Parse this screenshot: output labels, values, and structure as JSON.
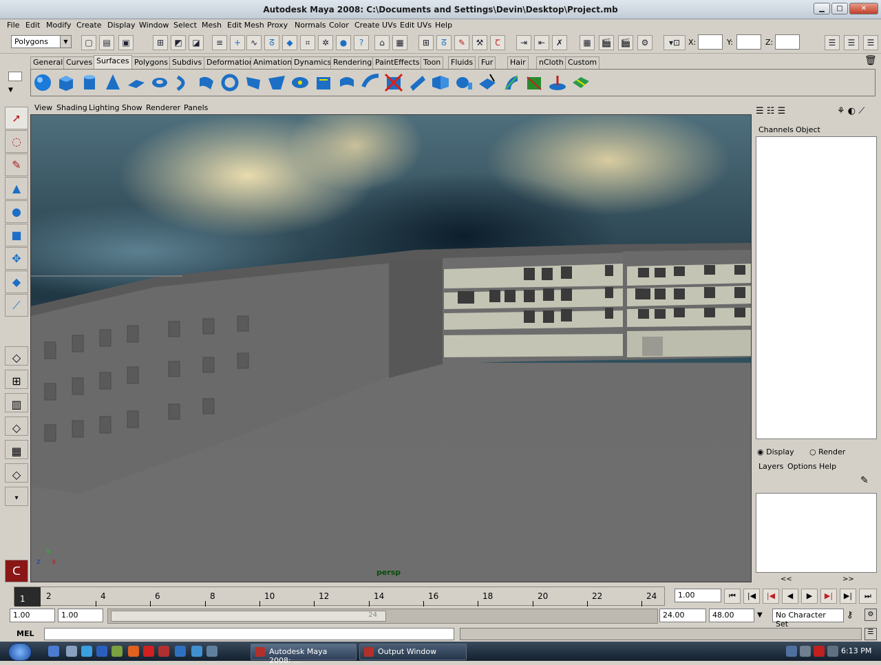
{
  "window": {
    "title": "Autodesk Maya 2008: C:\\Documents and Settings\\Devin\\Desktop\\Project.mb",
    "min": "▁",
    "max": "□",
    "close": "✕"
  },
  "menu": [
    "File",
    "Edit",
    "Modify",
    "Create",
    "Display",
    "Window",
    "Select",
    "Mesh",
    "Edit Mesh",
    "Proxy",
    "Normals",
    "Color",
    "Create UVs",
    "Edit UVs",
    "Help"
  ],
  "toolbar": {
    "mode": "Polygons",
    "x_label": "X:",
    "y_label": "Y:",
    "z_label": "Z:"
  },
  "shelf_tabs": [
    "General",
    "Curves",
    "Surfaces",
    "Polygons",
    "Subdivs",
    "Deformation",
    "Animation",
    "Dynamics",
    "Rendering",
    "PaintEffects",
    "Toon",
    "Fluids",
    "Fur",
    "Hair",
    "nCloth",
    "Custom"
  ],
  "shelf_active": "Surfaces",
  "panel_menu": [
    "View",
    "Shading",
    "Lighting",
    "Show",
    "Renderer",
    "Panels"
  ],
  "viewport": {
    "camera": "persp",
    "axis_x": "x",
    "axis_y": "y",
    "axis_z": "z"
  },
  "channel_box": {
    "tabs": [
      "Channels",
      "Object"
    ]
  },
  "layer_editor": {
    "display": "Display",
    "render": "Render",
    "menus": [
      "Layers",
      "Options",
      "Help"
    ],
    "scroll_left": "<<",
    "scroll_right": ">>"
  },
  "timeline": {
    "current": "1",
    "ticks": [
      "2",
      "4",
      "6",
      "8",
      "10",
      "12",
      "14",
      "16",
      "18",
      "20",
      "22",
      "24"
    ],
    "frame_field": "1.00"
  },
  "range": {
    "start": "1.00",
    "start2": "1.00",
    "end": "24.00",
    "end2": "48.00",
    "thumb_label": "24",
    "character_set": "No Character Set"
  },
  "mel": {
    "label": "MEL"
  },
  "taskbar": {
    "items": [
      "Autodesk Maya 2008: ...",
      "Output Window"
    ],
    "clock": "6:13 PM"
  },
  "colors": {
    "accent": "#1c6fc4",
    "background": "#d4d0c8"
  }
}
